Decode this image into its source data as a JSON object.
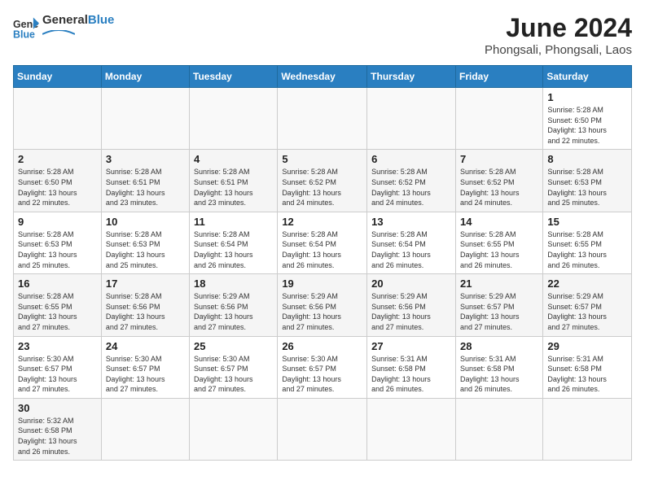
{
  "header": {
    "logo_general": "General",
    "logo_blue": "Blue",
    "title": "June 2024",
    "subtitle": "Phongsali, Phongsali, Laos"
  },
  "weekdays": [
    "Sunday",
    "Monday",
    "Tuesday",
    "Wednesday",
    "Thursday",
    "Friday",
    "Saturday"
  ],
  "weeks": [
    [
      {
        "day": "",
        "info": ""
      },
      {
        "day": "",
        "info": ""
      },
      {
        "day": "",
        "info": ""
      },
      {
        "day": "",
        "info": ""
      },
      {
        "day": "",
        "info": ""
      },
      {
        "day": "",
        "info": ""
      },
      {
        "day": "1",
        "info": "Sunrise: 5:28 AM\nSunset: 6:50 PM\nDaylight: 13 hours\nand 22 minutes."
      }
    ],
    [
      {
        "day": "2",
        "info": "Sunrise: 5:28 AM\nSunset: 6:50 PM\nDaylight: 13 hours\nand 22 minutes."
      },
      {
        "day": "3",
        "info": "Sunrise: 5:28 AM\nSunset: 6:51 PM\nDaylight: 13 hours\nand 23 minutes."
      },
      {
        "day": "4",
        "info": "Sunrise: 5:28 AM\nSunset: 6:51 PM\nDaylight: 13 hours\nand 23 minutes."
      },
      {
        "day": "5",
        "info": "Sunrise: 5:28 AM\nSunset: 6:52 PM\nDaylight: 13 hours\nand 24 minutes."
      },
      {
        "day": "6",
        "info": "Sunrise: 5:28 AM\nSunset: 6:52 PM\nDaylight: 13 hours\nand 24 minutes."
      },
      {
        "day": "7",
        "info": "Sunrise: 5:28 AM\nSunset: 6:52 PM\nDaylight: 13 hours\nand 24 minutes."
      },
      {
        "day": "8",
        "info": "Sunrise: 5:28 AM\nSunset: 6:53 PM\nDaylight: 13 hours\nand 25 minutes."
      }
    ],
    [
      {
        "day": "9",
        "info": "Sunrise: 5:28 AM\nSunset: 6:53 PM\nDaylight: 13 hours\nand 25 minutes."
      },
      {
        "day": "10",
        "info": "Sunrise: 5:28 AM\nSunset: 6:53 PM\nDaylight: 13 hours\nand 25 minutes."
      },
      {
        "day": "11",
        "info": "Sunrise: 5:28 AM\nSunset: 6:54 PM\nDaylight: 13 hours\nand 26 minutes."
      },
      {
        "day": "12",
        "info": "Sunrise: 5:28 AM\nSunset: 6:54 PM\nDaylight: 13 hours\nand 26 minutes."
      },
      {
        "day": "13",
        "info": "Sunrise: 5:28 AM\nSunset: 6:54 PM\nDaylight: 13 hours\nand 26 minutes."
      },
      {
        "day": "14",
        "info": "Sunrise: 5:28 AM\nSunset: 6:55 PM\nDaylight: 13 hours\nand 26 minutes."
      },
      {
        "day": "15",
        "info": "Sunrise: 5:28 AM\nSunset: 6:55 PM\nDaylight: 13 hours\nand 26 minutes."
      }
    ],
    [
      {
        "day": "16",
        "info": "Sunrise: 5:28 AM\nSunset: 6:55 PM\nDaylight: 13 hours\nand 27 minutes."
      },
      {
        "day": "17",
        "info": "Sunrise: 5:28 AM\nSunset: 6:56 PM\nDaylight: 13 hours\nand 27 minutes."
      },
      {
        "day": "18",
        "info": "Sunrise: 5:29 AM\nSunset: 6:56 PM\nDaylight: 13 hours\nand 27 minutes."
      },
      {
        "day": "19",
        "info": "Sunrise: 5:29 AM\nSunset: 6:56 PM\nDaylight: 13 hours\nand 27 minutes."
      },
      {
        "day": "20",
        "info": "Sunrise: 5:29 AM\nSunset: 6:56 PM\nDaylight: 13 hours\nand 27 minutes."
      },
      {
        "day": "21",
        "info": "Sunrise: 5:29 AM\nSunset: 6:57 PM\nDaylight: 13 hours\nand 27 minutes."
      },
      {
        "day": "22",
        "info": "Sunrise: 5:29 AM\nSunset: 6:57 PM\nDaylight: 13 hours\nand 27 minutes."
      }
    ],
    [
      {
        "day": "23",
        "info": "Sunrise: 5:30 AM\nSunset: 6:57 PM\nDaylight: 13 hours\nand 27 minutes."
      },
      {
        "day": "24",
        "info": "Sunrise: 5:30 AM\nSunset: 6:57 PM\nDaylight: 13 hours\nand 27 minutes."
      },
      {
        "day": "25",
        "info": "Sunrise: 5:30 AM\nSunset: 6:57 PM\nDaylight: 13 hours\nand 27 minutes."
      },
      {
        "day": "26",
        "info": "Sunrise: 5:30 AM\nSunset: 6:57 PM\nDaylight: 13 hours\nand 27 minutes."
      },
      {
        "day": "27",
        "info": "Sunrise: 5:31 AM\nSunset: 6:58 PM\nDaylight: 13 hours\nand 26 minutes."
      },
      {
        "day": "28",
        "info": "Sunrise: 5:31 AM\nSunset: 6:58 PM\nDaylight: 13 hours\nand 26 minutes."
      },
      {
        "day": "29",
        "info": "Sunrise: 5:31 AM\nSunset: 6:58 PM\nDaylight: 13 hours\nand 26 minutes."
      }
    ],
    [
      {
        "day": "30",
        "info": "Sunrise: 5:32 AM\nSunset: 6:58 PM\nDaylight: 13 hours\nand 26 minutes."
      },
      {
        "day": "",
        "info": ""
      },
      {
        "day": "",
        "info": ""
      },
      {
        "day": "",
        "info": ""
      },
      {
        "day": "",
        "info": ""
      },
      {
        "day": "",
        "info": ""
      },
      {
        "day": "",
        "info": ""
      }
    ]
  ]
}
